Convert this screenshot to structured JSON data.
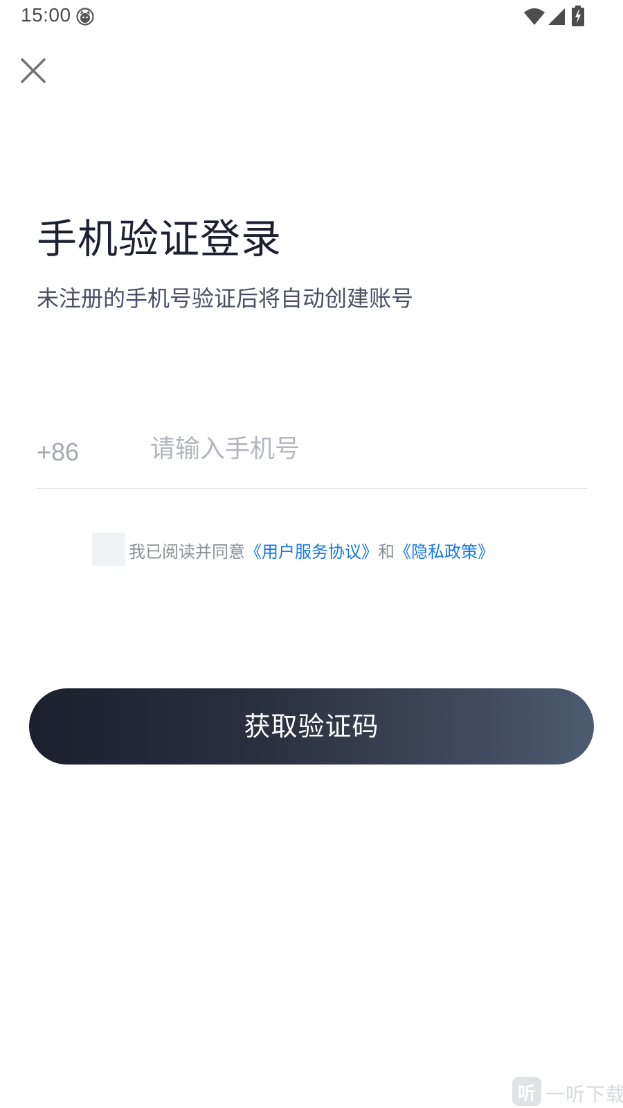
{
  "status_bar": {
    "time": "15:00",
    "icons": [
      "face-icon",
      "wifi-icon",
      "signal-icon",
      "battery-charging-icon"
    ]
  },
  "close_icon": "close-icon",
  "title": "手机验证登录",
  "subtitle": "未注册的手机号验证后将自动创建账号",
  "phone": {
    "country_code": "+86",
    "value": "",
    "placeholder": "请输入手机号"
  },
  "agreement": {
    "checked": false,
    "prefix": "我已阅读并同意",
    "terms_link": "《用户服务协议》",
    "conjunction": "和",
    "privacy_link": "《隐私政策》"
  },
  "submit_label": "获取验证码",
  "watermark": {
    "logo_char": "听",
    "text": "一听下载"
  },
  "colors": {
    "link": "#1677e8",
    "button_gradient_start": "#1c1f2c",
    "button_gradient_end": "#4d5a70",
    "checkbox_bg": "#f0f1f5"
  }
}
